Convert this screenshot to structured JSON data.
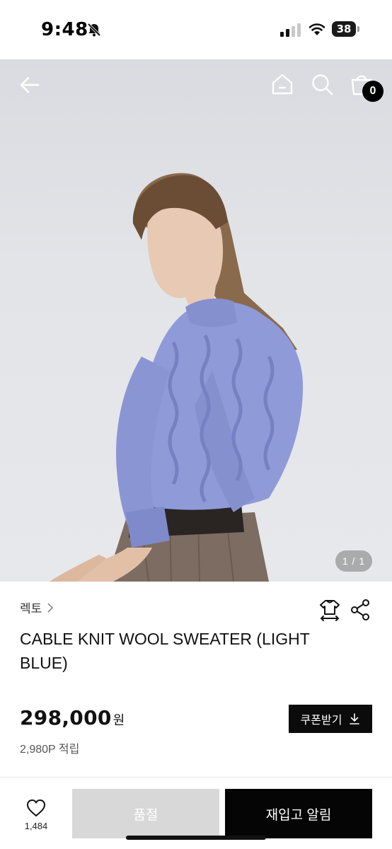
{
  "status_bar": {
    "time": "9:48",
    "battery": "38",
    "icons": [
      "bell-slash-icon",
      "cellular-signal-icon",
      "wifi-icon",
      "battery-icon"
    ]
  },
  "nav": {
    "icons": [
      "back-arrow-icon",
      "home-icon",
      "search-icon",
      "shopping-bag-icon"
    ],
    "cart_count": "0"
  },
  "gallery": {
    "pager": "1 / 1"
  },
  "product": {
    "brand": "렉토",
    "title": "CABLE KNIT WOOL SWEATER (LIGHT BLUE)",
    "price": "298,000",
    "price_unit": "원",
    "points": "2,980P 적립",
    "coupon_label": "쿠폰받기",
    "icons": [
      "size-guide-icon",
      "share-icon",
      "download-icon"
    ]
  },
  "bottom_bar": {
    "like_count": "1,484",
    "soldout_label": "품절",
    "restock_label": "재입고 알림",
    "icons": [
      "heart-icon"
    ]
  },
  "colors": {
    "accent": "#000000",
    "soldout_bg": "#d8d8d8",
    "sweater": "#8f9ad8",
    "hero_bg": "#e2e4e8"
  }
}
